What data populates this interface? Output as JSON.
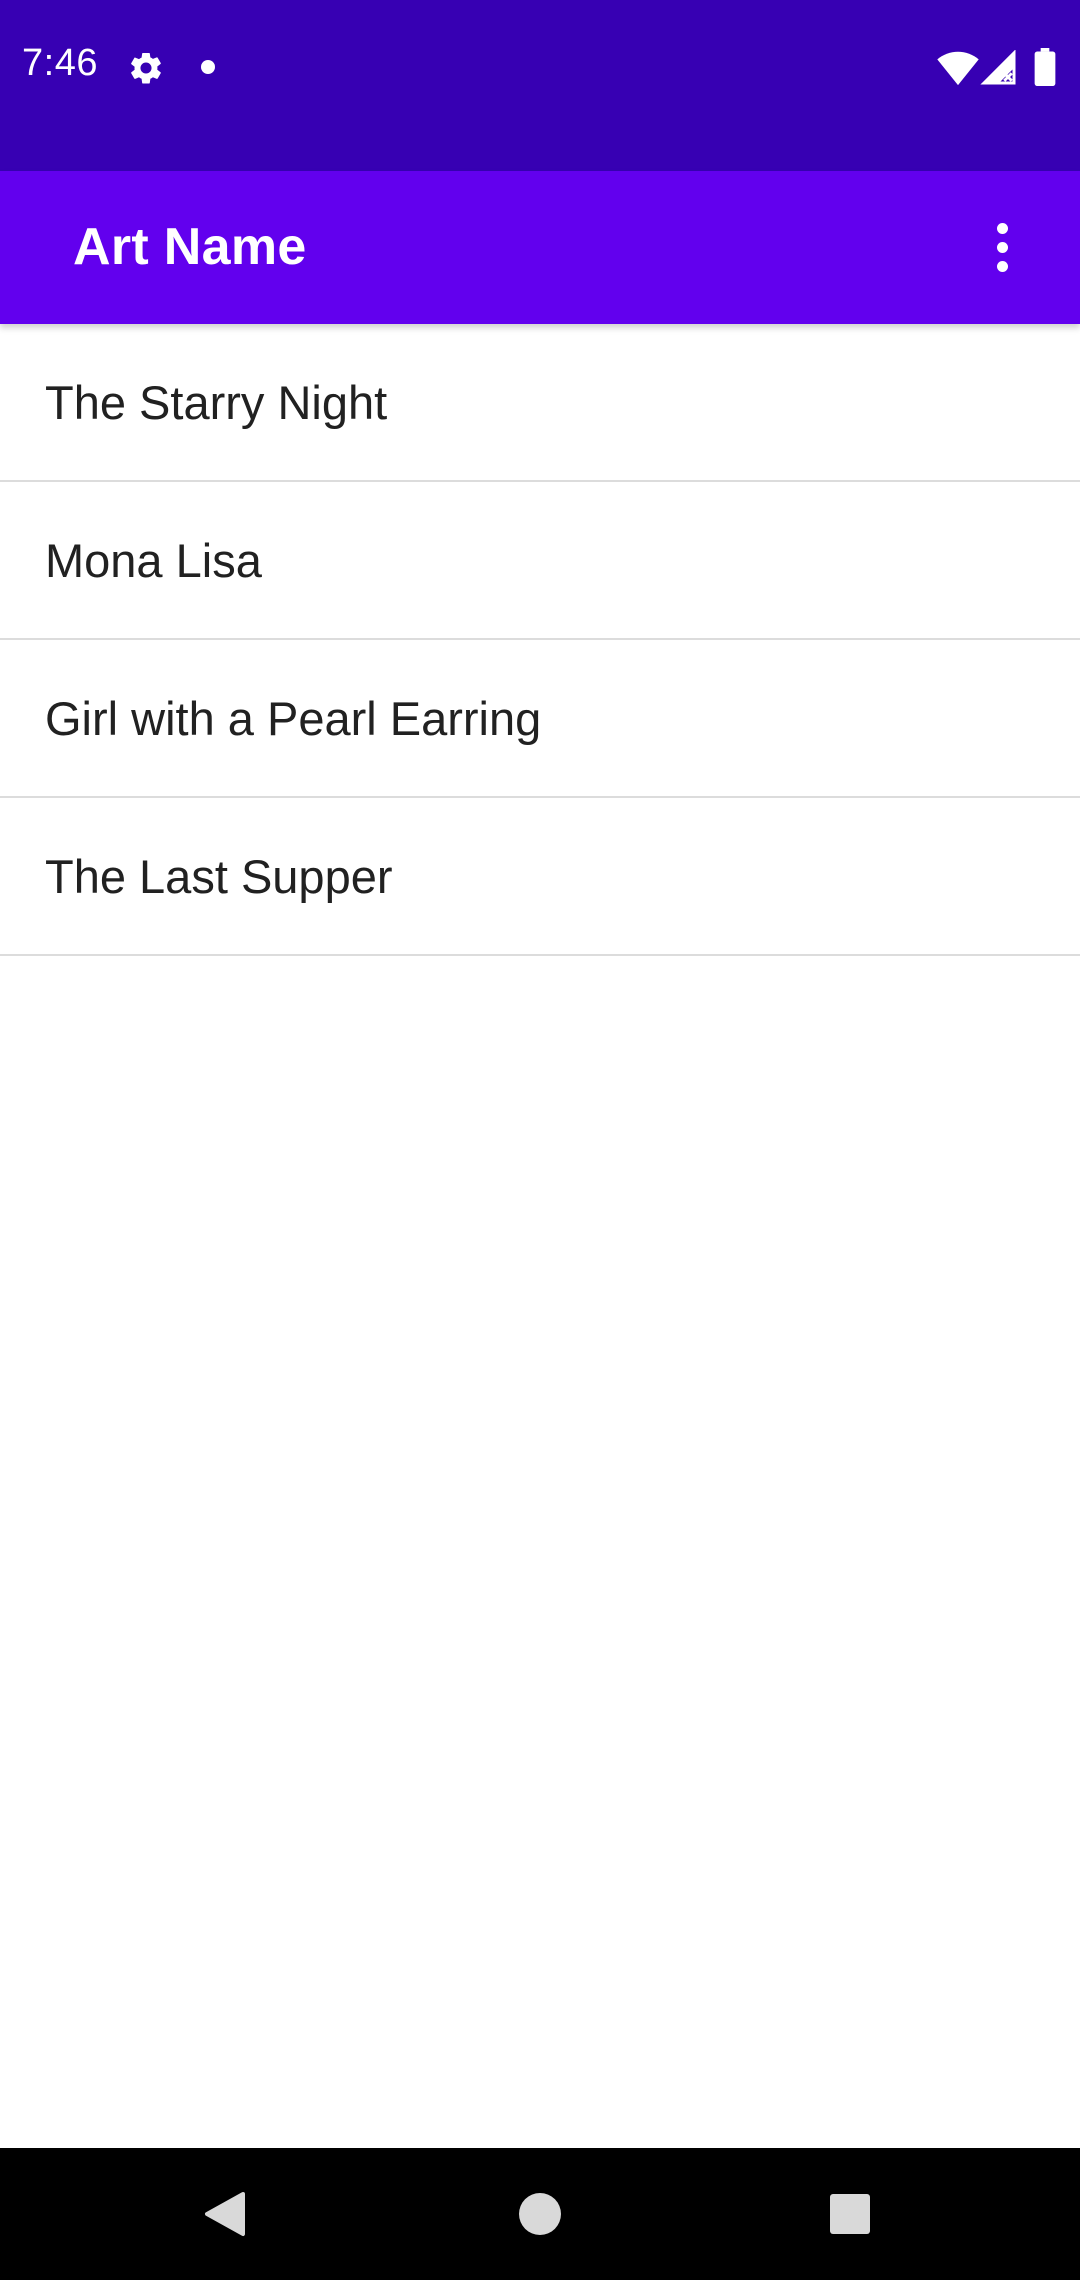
{
  "status_bar": {
    "time": "7:46",
    "background": "#3700B3",
    "icons": [
      "gear-icon",
      "notification-dot-icon",
      "wifi-icon",
      "cell-signal-icon",
      "battery-icon"
    ]
  },
  "app_bar": {
    "title": "Art Name",
    "background": "#6200EE",
    "menu_icon": "more-vert-icon"
  },
  "list": {
    "items": [
      {
        "label": "The Starry Night"
      },
      {
        "label": "Mona Lisa"
      },
      {
        "label": "Girl with a Pearl Earring"
      },
      {
        "label": "The Last Supper"
      }
    ]
  },
  "nav_bar": {
    "icons": [
      "back-icon",
      "home-icon",
      "recents-icon"
    ]
  }
}
